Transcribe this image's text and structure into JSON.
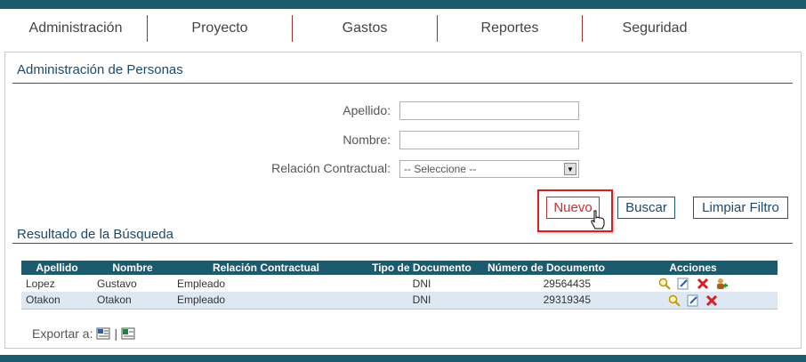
{
  "nav": {
    "items": [
      "Administración",
      "Proyecto",
      "Gastos",
      "Reportes",
      "Seguridad"
    ]
  },
  "page": {
    "title": "Administración de Personas",
    "results_title": "Resultado de la Búsqueda"
  },
  "form": {
    "apellido_label": "Apellido:",
    "apellido_value": "",
    "nombre_label": "Nombre:",
    "nombre_value": "",
    "relacion_label": "Relación Contractual:",
    "relacion_selected": "-- Seleccione --"
  },
  "buttons": {
    "nuevo": "Nuevo",
    "buscar": "Buscar",
    "limpiar": "Limpiar Filtro"
  },
  "table": {
    "headers": [
      "Apellido",
      "Nombre",
      "Relación Contractual",
      "Tipo de Documento",
      "Número de Documento",
      "Acciones"
    ],
    "rows": [
      [
        "Lopez",
        "Gustavo",
        "Empleado",
        "DNI",
        "29564435"
      ],
      [
        "Otakon",
        "Otakon",
        "Empleado",
        "DNI",
        "29319345"
      ]
    ]
  },
  "export": {
    "label": "Exportar a:",
    "separator": "|"
  },
  "colors": {
    "brand": "#1c5a6e",
    "accent": "#a52a2a",
    "row_alt": "#dde8f3"
  }
}
